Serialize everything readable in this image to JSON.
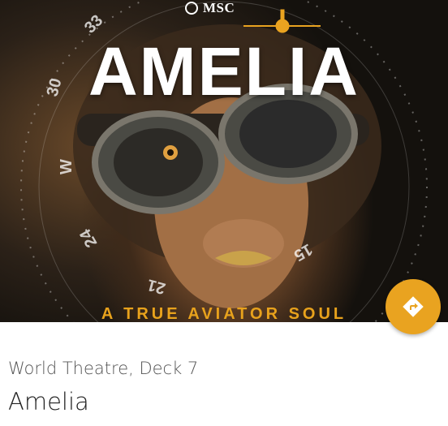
{
  "poster": {
    "brand": "MSC",
    "title": "AMELIA",
    "tagline": "A TRUE AVIATOR SOUL",
    "compass_marks": [
      "33",
      "30",
      "W",
      "24",
      "21",
      "15"
    ]
  },
  "action_button": {
    "icon": "directions-icon",
    "color": "#e9a320"
  },
  "show": {
    "location": "World Theatre, Deck 7",
    "name": "Amelia"
  },
  "colors": {
    "accent": "#e9a320",
    "tagline": "#e8a21c"
  }
}
